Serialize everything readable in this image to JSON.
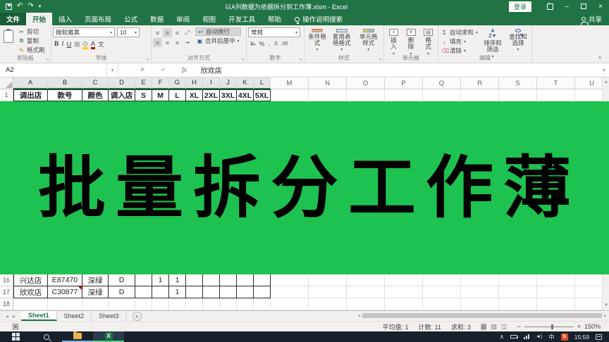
{
  "titlebar": {
    "title": "以A列数据为依据拆分到工作薄.xlsm - Excel",
    "signin": "登录"
  },
  "tabs": {
    "file": "文件",
    "items": [
      "开始",
      "插入",
      "页面布局",
      "公式",
      "数据",
      "审阅",
      "视图",
      "开发工具",
      "帮助"
    ],
    "active": "开始",
    "tell_me": "操作说明搜索",
    "share": "共享"
  },
  "ribbon": {
    "clipboard": {
      "label": "剪贴板",
      "cut": "剪切",
      "copy": "复制",
      "painter": "格式刷"
    },
    "font": {
      "label": "字体",
      "name": "微软雅黑",
      "size": "10"
    },
    "alignment": {
      "label": "对齐方式",
      "wrap": "自动换行",
      "merge": "合并后居中"
    },
    "number": {
      "label": "数字",
      "format": "常规"
    },
    "styles": {
      "label": "样式",
      "conditional": "条件格式",
      "table": "套用表格格式",
      "cell": "单元格样式"
    },
    "cells": {
      "label": "单元格",
      "insert": "插入",
      "delete": "删除",
      "format": "格式"
    },
    "editing": {
      "label": "编辑",
      "autosum": "自动求和",
      "fill": "填充",
      "clear": "清除",
      "sort": "排序和筛选",
      "find": "查找和选择"
    }
  },
  "formula_bar": {
    "name_box": "A2",
    "value": "欣欢店",
    "fx": "fx"
  },
  "grid": {
    "columns": [
      "A",
      "B",
      "C",
      "D",
      "E",
      "F",
      "G",
      "H",
      "I",
      "J",
      "K",
      "L",
      "M",
      "N",
      "O",
      "P",
      "Q",
      "R",
      "S",
      "T",
      "U"
    ],
    "shaded_column_count": 12,
    "rows": [
      {
        "num": "1",
        "header": true,
        "bordered": true,
        "cells": [
          "调出店",
          "款号",
          "颜色",
          "调入店",
          "S",
          "M",
          "L",
          "XL",
          "2XL",
          "3XL",
          "4XL",
          "5XL"
        ]
      },
      {
        "num": "16",
        "bordered": true,
        "cells": [
          "兴达店",
          "E87470",
          "深绿",
          "D",
          "",
          "1",
          "1",
          "",
          "",
          "",
          "",
          ""
        ]
      },
      {
        "num": "17",
        "bordered": true,
        "comment_col": 1,
        "cells": [
          "欣欢店",
          "C30877",
          "深绿",
          "D",
          "",
          "",
          "1",
          "",
          "",
          "",
          "",
          ""
        ]
      },
      {
        "num": "18",
        "bordered": false,
        "cells": [
          "",
          "",
          "",
          "",
          "",
          "",
          "",
          "",
          "",
          "",
          "",
          ""
        ]
      }
    ]
  },
  "banner": {
    "text": "批量拆分工作薄",
    "bg_color": "#1ec250",
    "text_color": "#000000"
  },
  "sheet_bar": {
    "tabs": [
      "Sheet1",
      "Sheet2",
      "Sheet3"
    ],
    "active": "Sheet1"
  },
  "status_bar": {
    "average": "平均值: 1",
    "count": "计数: 11",
    "sum": "求和: 3",
    "zoom_level": "150%"
  },
  "taskbar": {
    "ime": "中",
    "time": "15:59"
  },
  "icons": {
    "undo": "↶",
    "redo": "↷",
    "qat_dropdown": "▾",
    "minimize": "–",
    "close": "×",
    "cut": "✂",
    "copy": "⧉",
    "painter": "✎",
    "border": "⊞",
    "bold": "B",
    "italic": "I",
    "underline": "U",
    "grow_font": "A▴",
    "shrink_font": "A▾",
    "align": "≡",
    "currency": "¥",
    "percent": "%",
    "comma": ",",
    "dec_inc": ".0",
    "dec_dec": ".00",
    "autosum": "Σ",
    "fill": "↓",
    "clear": "⌫",
    "sheet_prev": "◂",
    "sheet_next": "▸",
    "add_sheet": "+",
    "chevron_up": "∧",
    "view_normal": "▦",
    "view_layout": "▥",
    "view_break": "◫",
    "zoom_out": "−",
    "zoom_in": "+",
    "scroll_up": "▲",
    "scroll_down": "▼",
    "scroll_left": "◂",
    "scroll_right": "▸",
    "dropdown": "▾",
    "fx_cancel": "✕",
    "fx_enter": "✓"
  },
  "colors": {
    "excel_green": "#217346",
    "banner_green": "#1ec250",
    "taskbar_dark": "#18202b"
  }
}
